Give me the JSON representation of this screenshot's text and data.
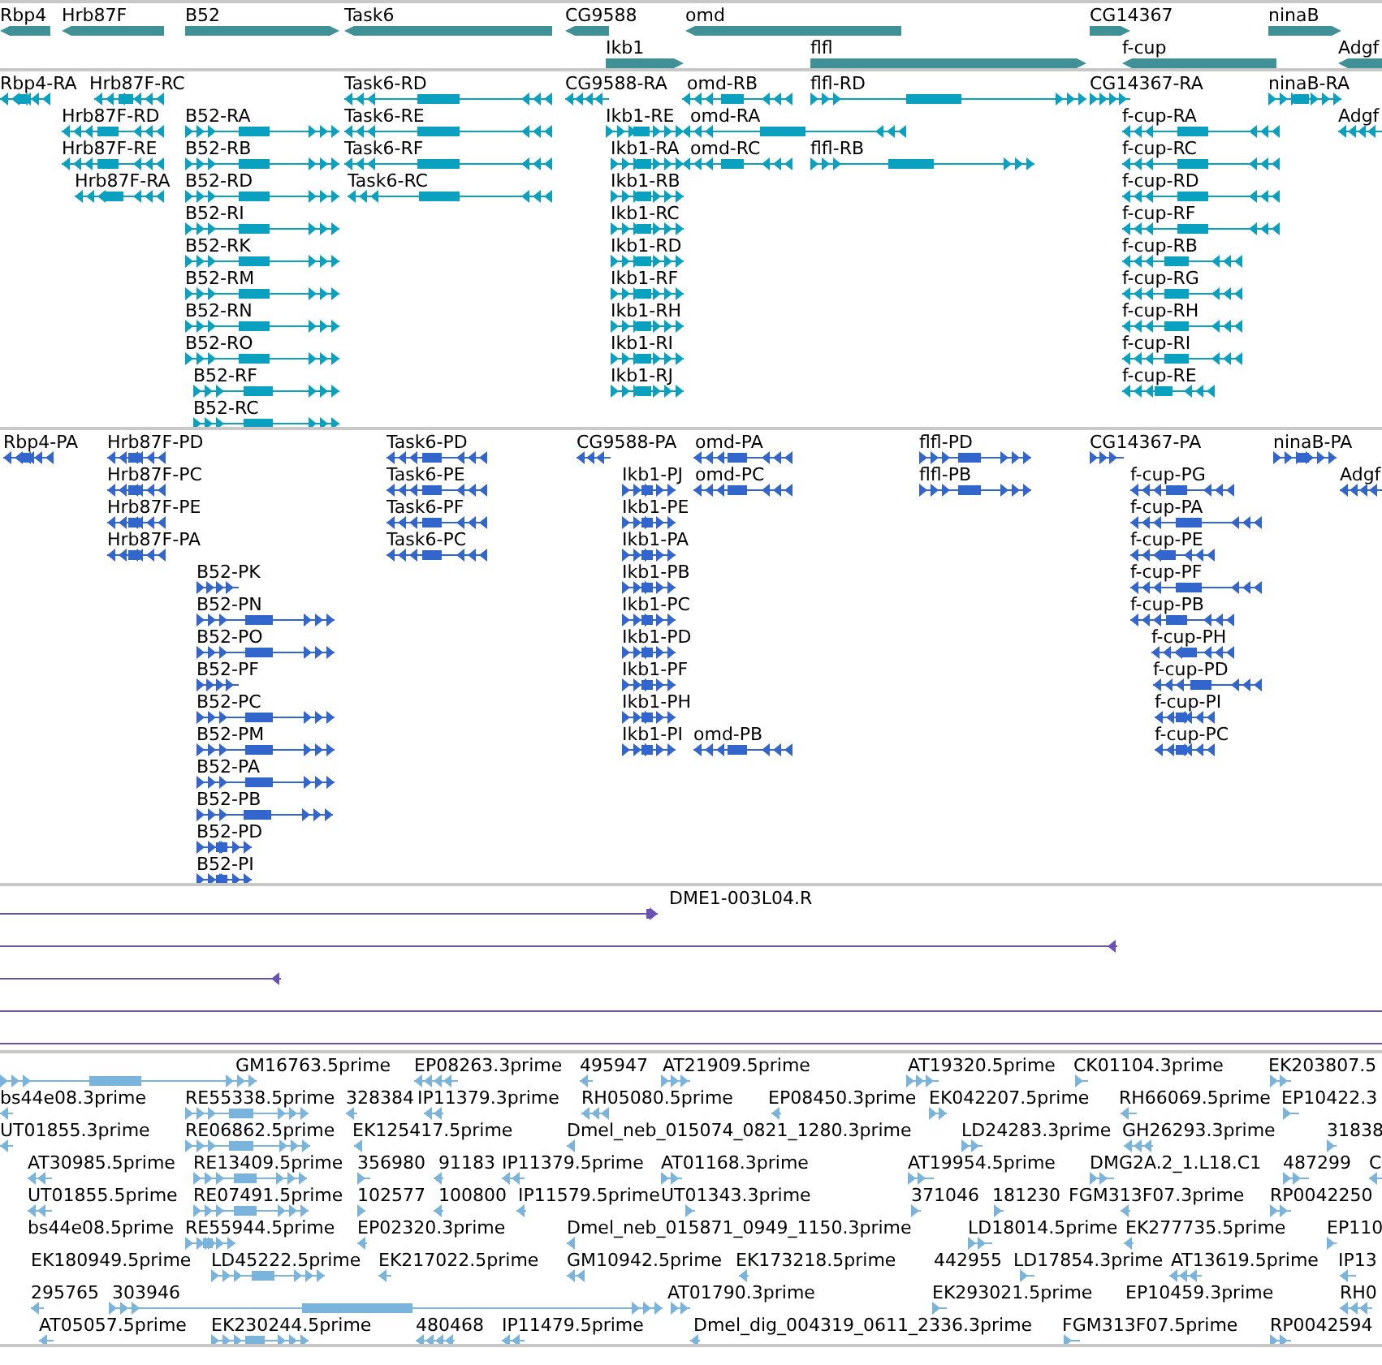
{
  "tracks": [
    {
      "kind": "gene",
      "color": "#3f9196",
      "features": [
        {
          "label": "Rbp4",
          "reverse": true
        },
        {
          "label": "Hrb87F",
          "reverse": true
        },
        {
          "label": "B52",
          "reverse": false
        },
        {
          "label": "Task6",
          "reverse": true
        },
        {
          "label": "CG9588",
          "reverse": true
        },
        {
          "label": "omd",
          "reverse": true
        },
        {
          "label": "CG14367",
          "reverse": false
        },
        {
          "label": "ninaB",
          "reverse": false
        },
        {
          "label": "Ikb1",
          "reverse": false
        },
        {
          "label": "flfl",
          "reverse": false
        },
        {
          "label": "f-cup",
          "reverse": true
        },
        {
          "label": "Adgf",
          "reverse": true
        }
      ]
    },
    {
      "kind": "transcript",
      "color": "#0aa0c0",
      "features": [
        {
          "label": "Rbp4-RA",
          "reverse": true
        },
        {
          "label": "Hrb87F-RC",
          "reverse": true
        },
        {
          "label": "Task6-RD",
          "reverse": true
        },
        {
          "label": "CG9588-RA",
          "reverse": true
        },
        {
          "label": "omd-RB",
          "reverse": true
        },
        {
          "label": "flfl-RD",
          "reverse": false
        },
        {
          "label": "CG14367-RA",
          "reverse": false
        },
        {
          "label": "ninaB-RA",
          "reverse": false
        },
        {
          "label": "Hrb87F-RD",
          "reverse": true
        },
        {
          "label": "B52-RA",
          "reverse": false
        },
        {
          "label": "Task6-RE",
          "reverse": true
        },
        {
          "label": "Ikb1-RE",
          "reverse": false
        },
        {
          "label": "omd-RA",
          "reverse": true
        },
        {
          "label": "f-cup-RA",
          "reverse": true
        },
        {
          "label": "Adgf",
          "reverse": true
        },
        {
          "label": "Hrb87F-RE",
          "reverse": true
        },
        {
          "label": "B52-RB",
          "reverse": false
        },
        {
          "label": "Task6-RF",
          "reverse": true
        },
        {
          "label": "Ikb1-RA",
          "reverse": false
        },
        {
          "label": "omd-RC",
          "reverse": true
        },
        {
          "label": "flfl-RB",
          "reverse": false
        },
        {
          "label": "f-cup-RC",
          "reverse": true
        },
        {
          "label": "Hrb87F-RA",
          "reverse": true
        },
        {
          "label": "B52-RD",
          "reverse": false
        },
        {
          "label": "Task6-RC",
          "reverse": true
        },
        {
          "label": "Ikb1-RB",
          "reverse": false
        },
        {
          "label": "f-cup-RD",
          "reverse": true
        },
        {
          "label": "B52-RI",
          "reverse": false
        },
        {
          "label": "Ikb1-RC",
          "reverse": false
        },
        {
          "label": "f-cup-RF",
          "reverse": true
        },
        {
          "label": "B52-RK",
          "reverse": false
        },
        {
          "label": "Ikb1-RD",
          "reverse": false
        },
        {
          "label": "f-cup-RB",
          "reverse": true
        },
        {
          "label": "B52-RM",
          "reverse": false
        },
        {
          "label": "Ikb1-RF",
          "reverse": false
        },
        {
          "label": "f-cup-RG",
          "reverse": true
        },
        {
          "label": "B52-RN",
          "reverse": false
        },
        {
          "label": "Ikb1-RH",
          "reverse": false
        },
        {
          "label": "f-cup-RH",
          "reverse": true
        },
        {
          "label": "B52-RO",
          "reverse": false
        },
        {
          "label": "Ikb1-RI",
          "reverse": false
        },
        {
          "label": "f-cup-RI",
          "reverse": true
        },
        {
          "label": "B52-RF",
          "reverse": false
        },
        {
          "label": "Ikb1-RJ",
          "reverse": false
        },
        {
          "label": "f-cup-RE",
          "reverse": true
        },
        {
          "label": "B52-RC",
          "reverse": false
        }
      ]
    },
    {
      "kind": "transcript",
      "color": "#3366cc",
      "features": [
        {
          "label": "Rbp4-PA",
          "reverse": true
        },
        {
          "label": "Hrb87F-PD",
          "reverse": true
        },
        {
          "label": "Task6-PD",
          "reverse": true
        },
        {
          "label": "CG9588-PA",
          "reverse": true
        },
        {
          "label": "omd-PA",
          "reverse": true
        },
        {
          "label": "flfl-PD",
          "reverse": false
        },
        {
          "label": "CG14367-PA",
          "reverse": false
        },
        {
          "label": "ninaB-PA",
          "reverse": false
        },
        {
          "label": "Hrb87F-PC",
          "reverse": true
        },
        {
          "label": "Task6-PE",
          "reverse": true
        },
        {
          "label": "Ikb1-PJ",
          "reverse": false
        },
        {
          "label": "omd-PC",
          "reverse": true
        },
        {
          "label": "flfl-PB",
          "reverse": false
        },
        {
          "label": "f-cup-PG",
          "reverse": true
        },
        {
          "label": "Adgf",
          "reverse": true
        },
        {
          "label": "Hrb87F-PE",
          "reverse": true
        },
        {
          "label": "Task6-PF",
          "reverse": true
        },
        {
          "label": "Ikb1-PE",
          "reverse": false
        },
        {
          "label": "f-cup-PA",
          "reverse": true
        },
        {
          "label": "Hrb87F-PA",
          "reverse": true
        },
        {
          "label": "Task6-PC",
          "reverse": true
        },
        {
          "label": "Ikb1-PA",
          "reverse": false
        },
        {
          "label": "f-cup-PE",
          "reverse": true
        },
        {
          "label": "B52-PK",
          "reverse": false
        },
        {
          "label": "Ikb1-PB",
          "reverse": false
        },
        {
          "label": "f-cup-PF",
          "reverse": true
        },
        {
          "label": "B52-PN",
          "reverse": false
        },
        {
          "label": "Ikb1-PC",
          "reverse": false
        },
        {
          "label": "f-cup-PB",
          "reverse": true
        },
        {
          "label": "B52-PO",
          "reverse": false
        },
        {
          "label": "Ikb1-PD",
          "reverse": false
        },
        {
          "label": "f-cup-PH",
          "reverse": true
        },
        {
          "label": "B52-PF",
          "reverse": false
        },
        {
          "label": "Ikb1-PF",
          "reverse": false
        },
        {
          "label": "f-cup-PD",
          "reverse": true
        },
        {
          "label": "B52-PC",
          "reverse": false
        },
        {
          "label": "Ikb1-PH",
          "reverse": false
        },
        {
          "label": "f-cup-PI",
          "reverse": true
        },
        {
          "label": "B52-PM",
          "reverse": false
        },
        {
          "label": "Ikb1-PI",
          "reverse": false
        },
        {
          "label": "omd-PB",
          "reverse": true
        },
        {
          "label": "f-cup-PC",
          "reverse": true
        },
        {
          "label": "B52-PA",
          "reverse": false
        },
        {
          "label": "B52-PB",
          "reverse": false
        },
        {
          "label": "B52-PD",
          "reverse": false
        },
        {
          "label": "B52-PI",
          "reverse": false
        }
      ]
    },
    {
      "kind": "read",
      "color": "#6b52b2",
      "features": [
        {
          "label": "DME1-003L04.R",
          "reverse": false,
          "arrowhead": true
        },
        {
          "reverse": true,
          "arrowhead": true
        },
        {
          "reverse": true,
          "arrowhead": true
        },
        {
          "arrowhead": false
        },
        {
          "arrowhead": false
        }
      ]
    },
    {
      "kind": "transcript",
      "color": "#7ab4dc",
      "features": [
        {
          "label": "GM16763.5prime",
          "reverse": false
        },
        {
          "label": "EP08263.3prime",
          "reverse": true
        },
        {
          "label": "495947",
          "reverse": true
        },
        {
          "label": "AT21909.5prime",
          "reverse": false
        },
        {
          "label": "AT19320.5prime",
          "reverse": false
        },
        {
          "label": "CK01104.3prime",
          "reverse": false
        },
        {
          "label": "EK203807.5",
          "reverse": false
        },
        {
          "label": "bs44e08.3prime",
          "reverse": true
        },
        {
          "label": "RE55338.5prime",
          "reverse": false
        },
        {
          "label": "328384",
          "reverse": true
        },
        {
          "label": "IP11379.3prime",
          "reverse": true
        },
        {
          "label": "RH05080.5prime",
          "reverse": true
        },
        {
          "label": "EP08450.3prime",
          "reverse": true
        },
        {
          "label": "EK042207.5prime",
          "reverse": false
        },
        {
          "label": "RH66069.5prime",
          "reverse": true
        },
        {
          "label": "EP10422.3",
          "reverse": false
        },
        {
          "label": "UT01855.3prime",
          "reverse": true
        },
        {
          "label": "RE06862.5prime",
          "reverse": false
        },
        {
          "label": "EK125417.5prime",
          "reverse": true
        },
        {
          "label": "Dmel_neb_015074_0821_1280.3prime",
          "reverse": true
        },
        {
          "label": "LD24283.3prime",
          "reverse": false
        },
        {
          "label": "GH26293.3prime",
          "reverse": true
        },
        {
          "label": "31838",
          "reverse": false
        },
        {
          "label": "AT30985.5prime",
          "reverse": true
        },
        {
          "label": "RE13409.5prime",
          "reverse": false
        },
        {
          "label": "356980",
          "reverse": false
        },
        {
          "label": "91183",
          "reverse": true
        },
        {
          "label": "IP11379.5prime",
          "reverse": true
        },
        {
          "label": "AT01168.3prime",
          "reverse": false
        },
        {
          "label": "AT19954.5prime",
          "reverse": false
        },
        {
          "label": "DMG2A.2_1.L18.C1",
          "reverse": false
        },
        {
          "label": "487299",
          "reverse": false
        },
        {
          "label": "C",
          "reverse": true
        },
        {
          "label": "UT01855.5prime",
          "reverse": true
        },
        {
          "label": "RE07491.5prime",
          "reverse": false
        },
        {
          "label": "102577",
          "reverse": false
        },
        {
          "label": "100800",
          "reverse": true
        },
        {
          "label": "IP11579.5prime",
          "reverse": true
        },
        {
          "label": "UT01343.3prime",
          "reverse": false
        },
        {
          "label": "371046",
          "reverse": false
        },
        {
          "label": "181230",
          "reverse": false
        },
        {
          "label": "FGM313F07.3prime",
          "reverse": true
        },
        {
          "label": "RP0042250",
          "reverse": false
        },
        {
          "label": "bs44e08.5prime"
        },
        {
          "label": "RE55944.5prime",
          "reverse": false
        },
        {
          "label": "EP02320.3prime",
          "reverse": true
        },
        {
          "label": "Dmel_neb_015871_0949_1150.3prime",
          "reverse": true
        },
        {
          "label": "LD18014.5prime",
          "reverse": false
        },
        {
          "label": "EK277735.5prime",
          "reverse": true
        },
        {
          "label": "EP110",
          "reverse": false
        },
        {
          "label": "EK180949.5prime"
        },
        {
          "label": "LD45222.5prime",
          "reverse": false
        },
        {
          "label": "EK217022.5prime",
          "reverse": true
        },
        {
          "label": "GM10942.5prime",
          "reverse": true
        },
        {
          "label": "EK173218.5prime",
          "reverse": true
        },
        {
          "label": "442955"
        },
        {
          "label": "LD17854.3prime",
          "reverse": false
        },
        {
          "label": "AT13619.5prime",
          "reverse": true
        },
        {
          "label": "IP13",
          "reverse": true
        },
        {
          "label": "295765",
          "reverse": true
        },
        {
          "label": "303946",
          "reverse": false
        },
        {
          "label": "AT01790.3prime",
          "reverse": false
        },
        {
          "label": "EK293021.5prime",
          "reverse": false
        },
        {
          "label": "EP10459.3prime"
        },
        {
          "label": "RH0",
          "reverse": true
        },
        {
          "label": "AT05057.5prime",
          "reverse": true
        },
        {
          "label": "EK230244.5prime",
          "reverse": false
        },
        {
          "label": "480468",
          "reverse": true
        },
        {
          "label": "IP11479.5prime",
          "reverse": true
        },
        {
          "label": "Dmel_dig_004319_0611_2336.3prime",
          "reverse": true
        },
        {
          "label": "FGM313F07.5prime",
          "reverse": false
        },
        {
          "label": "RP0042594",
          "reverse": false
        }
      ]
    }
  ]
}
